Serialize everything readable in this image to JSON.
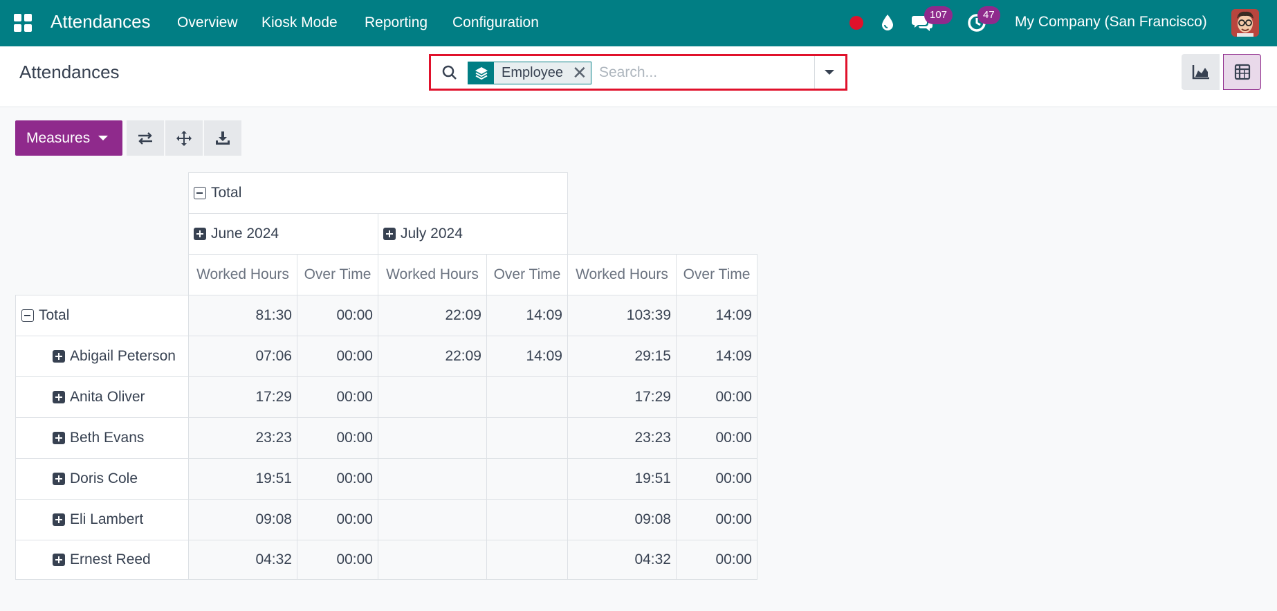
{
  "navbar": {
    "app_name": "Attendances",
    "menu": [
      "Overview",
      "Kiosk Mode",
      "Reporting",
      "Configuration"
    ],
    "chat_badge": "107",
    "activity_badge": "47",
    "company": "My Company (San Francisco)",
    "colors": {
      "bar": "#017e84",
      "badge": "#8f2a8c",
      "record": "#e0112b"
    }
  },
  "control": {
    "title": "Attendances",
    "search": {
      "facet_label": "Employee",
      "facet_icon": "group-by-layers-icon",
      "placeholder": "Search..."
    },
    "views": [
      "graph-view-icon",
      "pivot-view-icon"
    ],
    "active_view": "pivot"
  },
  "toolbar": {
    "measures_label": "Measures",
    "tools": [
      "flip-axis-icon",
      "expand-all-icon",
      "download-xlsx-icon"
    ]
  },
  "pivot": {
    "column_total_label": "Total",
    "column_groups": [
      "June 2024",
      "July 2024"
    ],
    "measures": [
      "Worked Hours",
      "Over Time",
      "Worked Hours",
      "Over Time",
      "Worked Hours",
      "Over Time"
    ],
    "total_row": {
      "label": "Total",
      "values": [
        "81:30",
        "00:00",
        "22:09",
        "14:09",
        "103:39",
        "14:09"
      ]
    },
    "rows": [
      {
        "label": "Abigail Peterson",
        "values": [
          "07:06",
          "00:00",
          "22:09",
          "14:09",
          "29:15",
          "14:09"
        ]
      },
      {
        "label": "Anita Oliver",
        "values": [
          "17:29",
          "00:00",
          "",
          "",
          "17:29",
          "00:00"
        ]
      },
      {
        "label": "Beth Evans",
        "values": [
          "23:23",
          "00:00",
          "",
          "",
          "23:23",
          "00:00"
        ]
      },
      {
        "label": "Doris Cole",
        "values": [
          "19:51",
          "00:00",
          "",
          "",
          "19:51",
          "00:00"
        ]
      },
      {
        "label": "Eli Lambert",
        "values": [
          "09:08",
          "00:00",
          "",
          "",
          "09:08",
          "00:00"
        ]
      },
      {
        "label": "Ernest Reed",
        "values": [
          "04:32",
          "00:00",
          "",
          "",
          "04:32",
          "00:00"
        ]
      }
    ]
  }
}
